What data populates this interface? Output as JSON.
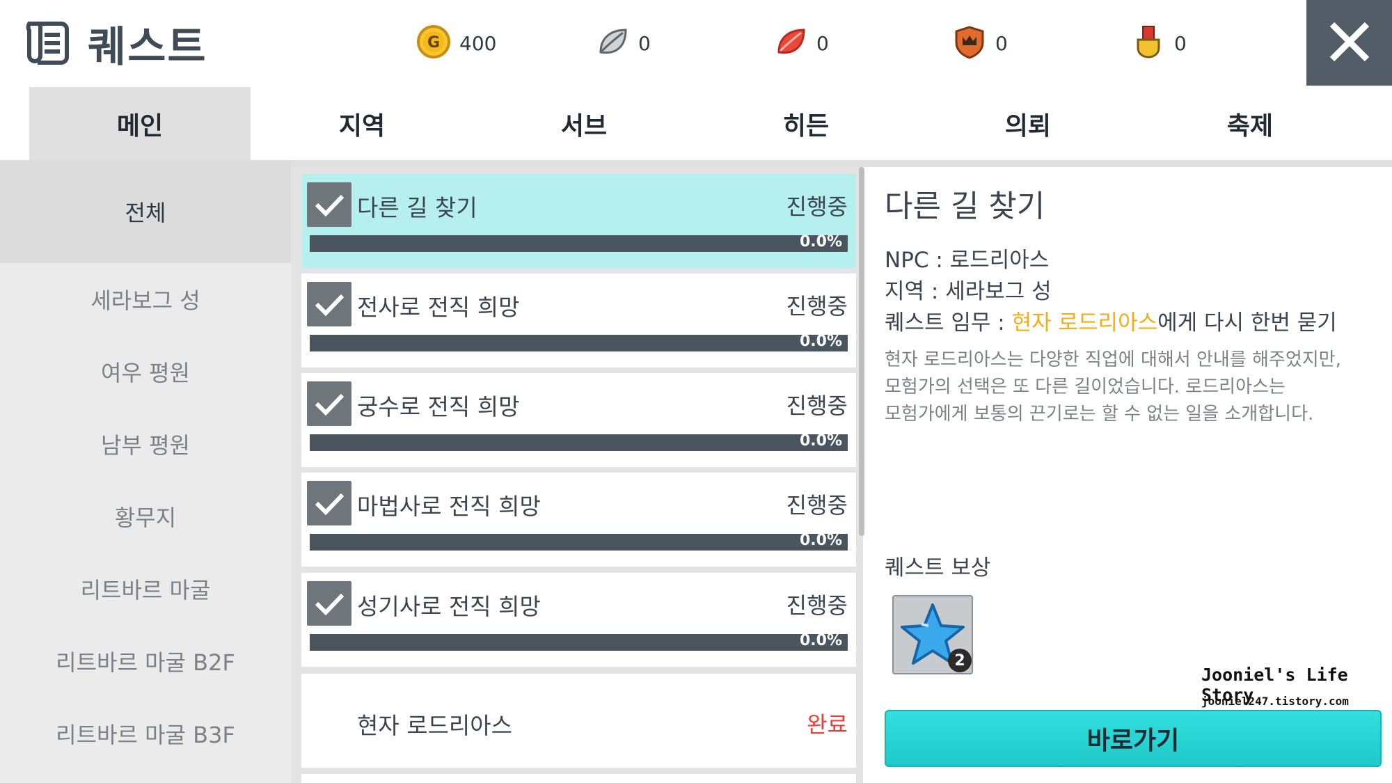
{
  "header": {
    "title": "퀘스트",
    "title_icon": "scroll-icon",
    "currencies": [
      {
        "icon": "gold-coin-icon",
        "amount": "400"
      },
      {
        "icon": "silver-leaf-icon",
        "amount": "0"
      },
      {
        "icon": "red-leaf-icon",
        "amount": "0"
      },
      {
        "icon": "crown-shield-icon",
        "amount": "0"
      },
      {
        "icon": "medal-icon",
        "amount": "0"
      }
    ],
    "close_icon": "close-icon"
  },
  "tabs": [
    {
      "label": "메인",
      "active": true
    },
    {
      "label": "지역",
      "active": false
    },
    {
      "label": "서브",
      "active": false
    },
    {
      "label": "히든",
      "active": false
    },
    {
      "label": "의뢰",
      "active": false
    },
    {
      "label": "축제",
      "active": false
    }
  ],
  "sidebar": {
    "items": [
      {
        "label": "전체",
        "active": true
      },
      {
        "label": "세라보그 성"
      },
      {
        "label": "여우 평원"
      },
      {
        "label": "남부 평원"
      },
      {
        "label": "황무지"
      },
      {
        "label": "리트바르 마굴"
      },
      {
        "label": "리트바르 마굴 B2F"
      },
      {
        "label": "리트바르 마굴 B3F"
      }
    ]
  },
  "quests": [
    {
      "name": "다른 길 찾기",
      "status": "진행중",
      "progress": 0.0,
      "progress_label": "0.0%",
      "checked": true,
      "active": true
    },
    {
      "name": "전사로 전직 희망",
      "status": "진행중",
      "progress": 0.0,
      "progress_label": "0.0%",
      "checked": true
    },
    {
      "name": "궁수로 전직 희망",
      "status": "진행중",
      "progress": 0.0,
      "progress_label": "0.0%",
      "checked": true
    },
    {
      "name": "마법사로 전직 희망",
      "status": "진행중",
      "progress": 0.0,
      "progress_label": "0.0%",
      "checked": true
    },
    {
      "name": "성기사로 전직 희망",
      "status": "진행중",
      "progress": 0.0,
      "progress_label": "0.0%",
      "checked": true
    },
    {
      "name": "현자 로드리아스",
      "status": "완료"
    }
  ],
  "detail": {
    "title": "다른 길 찾기",
    "npc_label": "NPC : 로드리아스",
    "region_label": "지역 : 세라보그 성",
    "task_prefix": "퀘스트 임무 : ",
    "task_highlight": "현자 로드리아스",
    "task_suffix": "에게 다시 한번 묻기",
    "description_lines": [
      "현자 로드리아스는 다양한 직업에 대해서 안내를 해주었지만,",
      "모험가의 선택은 또 다른 길이었습니다. 로드리아스는",
      "모험가에게 보통의 끈기로는 할 수 없는 일을 소개합니다."
    ],
    "reward_title": "퀘스트 보상",
    "reward": {
      "icon": "blue-star-icon",
      "count": "2"
    },
    "go_button": "바로가기"
  },
  "watermark": {
    "title": "Jooniel's Life Story",
    "url": "jooniel247.tistory.com"
  },
  "colors": {
    "accent_cyan": "#2ed3d3",
    "active_row": "#b5f0ef",
    "complete_red": "#ef3e36",
    "highlight_orange": "#f5ac16",
    "close_bg": "#525c66"
  }
}
